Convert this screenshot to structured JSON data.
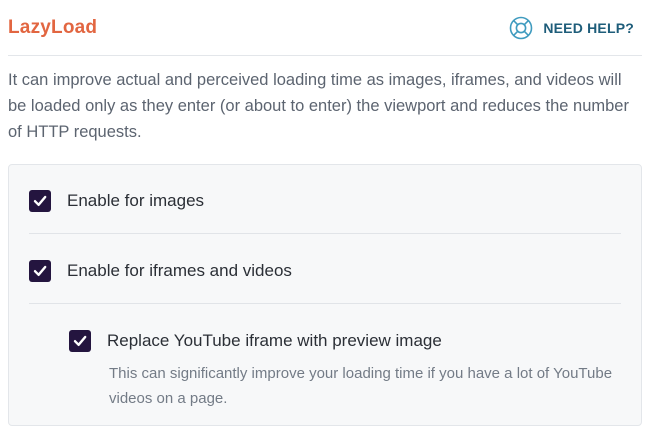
{
  "header": {
    "title": "LazyLoad",
    "help_label": "NEED HELP?",
    "help_icon": "lifebuoy-icon"
  },
  "description": "It can improve actual and perceived loading time as images, iframes, and videos will be loaded only as they enter (or about to enter) the viewport and reduces the number of HTTP requests.",
  "options": [
    {
      "label": "Enable for images",
      "checked": true
    },
    {
      "label": "Enable for iframes and videos",
      "checked": true
    },
    {
      "label": "Replace YouTube iframe with preview image",
      "checked": true,
      "help_text": "This can significantly improve your loading time if you have a lot of YouTube videos on a page."
    }
  ],
  "colors": {
    "title": "#e26641",
    "help": "#1e5d7a",
    "checkbox": "#24153f",
    "panel_bg": "#f7f8f9"
  }
}
